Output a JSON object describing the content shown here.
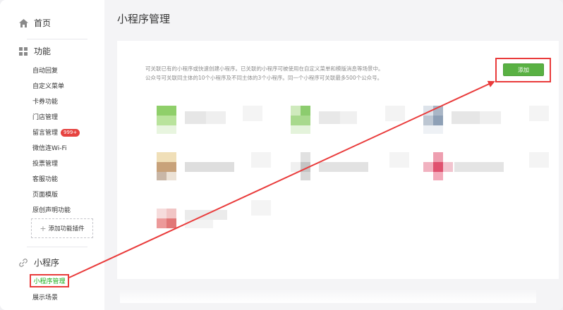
{
  "sidebar": {
    "home_label": "首页",
    "features_label": "功能",
    "feature_items": [
      {
        "label": "自动回复"
      },
      {
        "label": "自定义菜单"
      },
      {
        "label": "卡券功能"
      },
      {
        "label": "门店管理"
      },
      {
        "label": "留言管理",
        "badge": "999+"
      },
      {
        "label": "微信连Wi-Fi"
      },
      {
        "label": "投票管理"
      },
      {
        "label": "客服功能"
      },
      {
        "label": "页面模版"
      },
      {
        "label": "原创声明功能"
      }
    ],
    "add_plugin_label": "添加功能插件",
    "miniprogram_label": "小程序",
    "miniprogram_items": [
      {
        "label": "小程序管理"
      },
      {
        "label": "展示场景"
      }
    ]
  },
  "main": {
    "page_title": "小程序管理",
    "description_lines": [
      "可关联已有的小程序或快速创建小程序。已关联的小程序可被使用在自定义菜单和模版消息等场景中。",
      "公众号可关联同主体的10个小程序及不同主体的3个小程序。同一个小程序可关联最多500个公众号。"
    ],
    "add_button_label": "添加"
  },
  "colors": {
    "accent_green": "#59b143",
    "annotation_red": "#e93b3b",
    "badge_red": "#e64340"
  },
  "icons": {
    "home": "home-icon",
    "features": "grid-icon",
    "miniprogram": "link-icon"
  }
}
